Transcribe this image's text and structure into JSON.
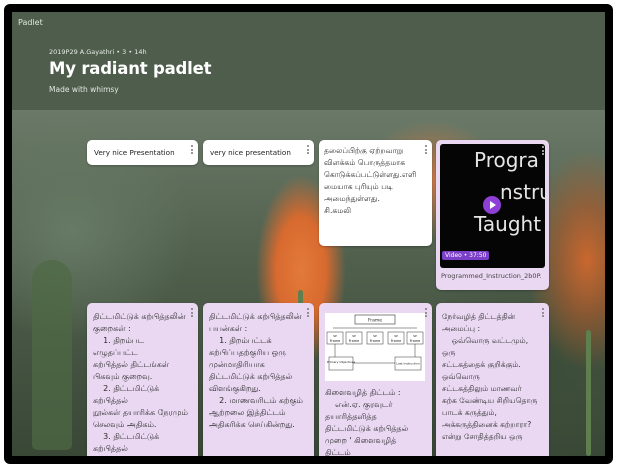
{
  "app": {
    "brand": "Padlet"
  },
  "header": {
    "meta": "2019P29 A.Gayathri • 3 • 14h",
    "title": "My radiant padlet",
    "subtitle": "Made with whimsy"
  },
  "posts": [
    {
      "text": "Very nice Presentation"
    },
    {
      "text": "very nice presentation"
    },
    {
      "text": "தலைப்பிற்கு ஏற்றவாறு\nவிளக்கம் பொருத்தமாக\nகொடுக்கப்பட்டுள்ளது.எளி\nமையாக புரியும் படி\nஅமைந்துள்ளது.\nசி.கமலி"
    },
    {
      "video_words": [
        "Progra",
        "nstruc",
        "Taught by J"
      ],
      "badge": "Video • 37:50",
      "caption": "Programmed_Instruction_2b0P..."
    }
  ],
  "columns": [
    {
      "text": "திட்டமிட்டுக் கற்பித்தலின்\nகுறைகள் :\n    1. திறம்பட எழுதப்பட்ட\nகற்பித்தல் திட்டங்கள்\nபிகவும் குறைவு.\n    2. திட்டமிட்டுக் கற்பித்தல்\nநூல்கள் தயாரிக்க நேரமும்\nசெலவும் அதிகம்.\n    3. திட்டமிட்டுக் கற்பித்தல்\nமுறையில் பயிலும்"
    },
    {
      "text": "திட்டமிட்டுக் கற்பித்தலின்\nபயன்கள் :\n    1. திறம்பட்டக்\nகற்பிப்பதற்குரிய ஒரு\nமுன்மாதிரியாக\nதிட்டமிட்டுக் கற்பித்தல்\nவிளங்குகிறது.\n    2. மாணவரிடம் கற்கும்\nஆற்றலை இத்திட்டம்\nஅதிகரிக்க செய்கின்றது."
    },
    {
      "diagram": {
        "top": "Frame",
        "frames": [
          "Frame",
          "Frame",
          "Frame",
          "Frame",
          "Frame"
        ],
        "small": [
          "SP",
          "SP",
          "SP",
          "SP",
          "SP"
        ],
        "bottom_left": "Primary Objectives",
        "bottom_right": "Last Instruction"
      },
      "text": "கிளைவழித் திட்டம் :\n    என்.ஏ. குரவுடர்\nதயாரித்தளித்த\nதிட்டமிட்டுக் கற்பித்தல்\nமுறை ' கிளைவழித் திட்டம்"
    },
    {
      "text": "நேர்வழித் திட்டத்தின்\nஅமைப்பு :\n    ஒவ்வொரு வட்டமும், ஒரு\nசட்டகத்தைக் குறிக்கும்.\nஒவ்வொரு\nசட்டகத்திலும் மாணவர்\nகற்க வேண்டிய சிறியதொரு\nபாடக் கருத்தும்,\nஅக்கருத்தினைக் கற்றாரா?\nஎன்று சோதித்தறிய ஒரு"
    }
  ]
}
